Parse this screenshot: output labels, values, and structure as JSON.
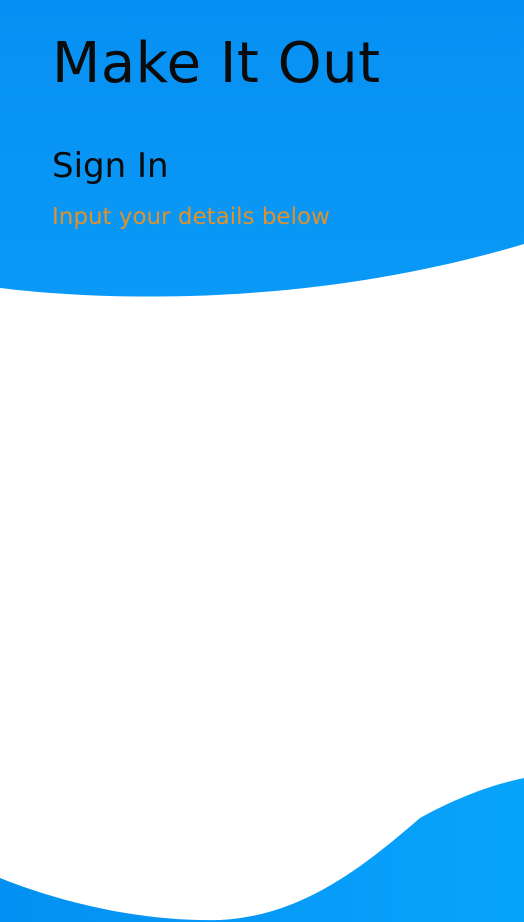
{
  "app": {
    "title": "Make It Out"
  },
  "signin": {
    "heading": "Sign In",
    "subtitle": "Input your details below"
  },
  "colors": {
    "wave_blue_top": "#0693f4",
    "wave_blue_bottom": "#069df8",
    "subtitle_orange": "#e2912a",
    "background": "#ffffff",
    "text_dark": "#0b0b0b"
  }
}
